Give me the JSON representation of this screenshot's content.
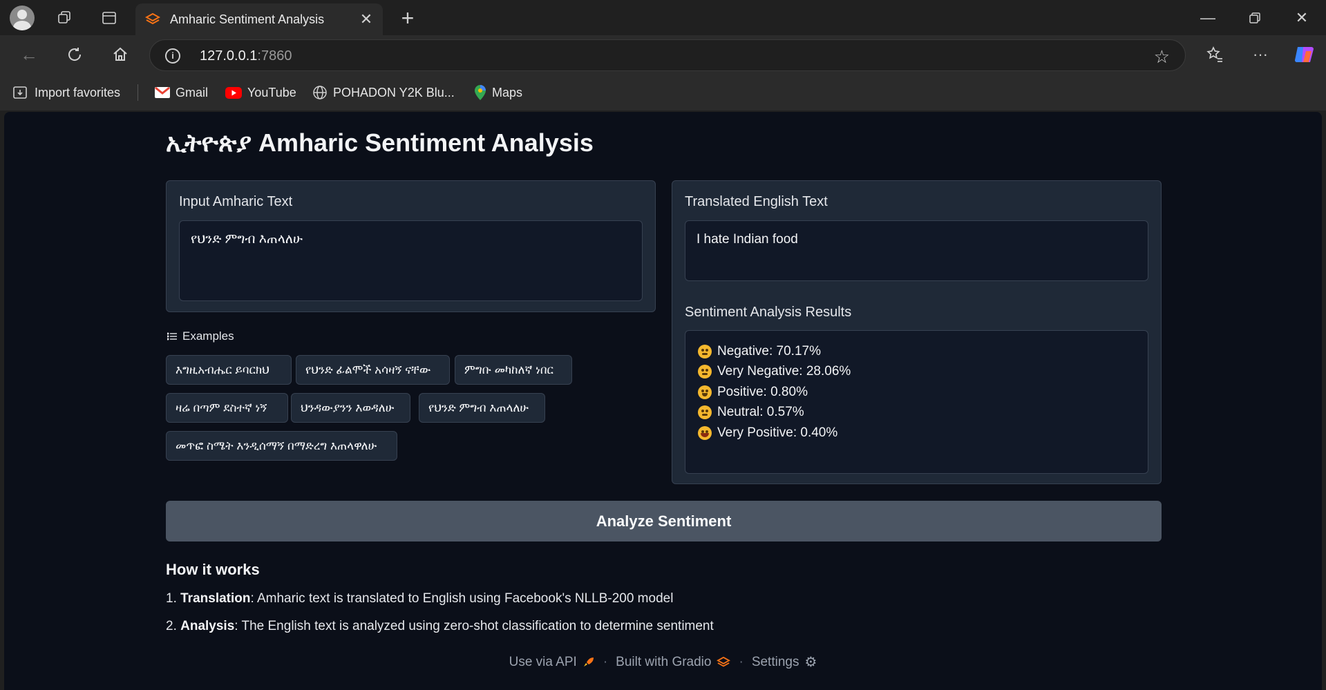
{
  "browser": {
    "tab_title": "Amharic Sentiment Analysis",
    "url_host": "127.0.0.1",
    "url_port": ":7860",
    "bookmarks": [
      "Import favorites",
      "Gmail",
      "YouTube",
      "POHADON Y2K Blu...",
      "Maps"
    ]
  },
  "app": {
    "title": "ኢትዮጵያ Amharic Sentiment Analysis",
    "input_label": "Input Amharic Text",
    "input_value": "የህንድ ምግብ እጠላለሁ",
    "examples_label": "Examples",
    "examples": [
      "እግዚአብሔር ይባርክህ",
      "የህንድ ፊልሞች አሳዛኝ ናቸው",
      "ምግቡ መካከለኛ ነበር",
      "ዛሬ በጣም ደስተኛ ነኝ",
      "ህንዳውያንን እወዳለሁ",
      "የህንድ ምግብ እጠላለሁ",
      "መጥፎ ስሜት እንዲሰማኝ በማድረግ እጠላዋለሁ"
    ],
    "translated_label": "Translated English Text",
    "translated_value": "I hate Indian food",
    "results_label": "Sentiment Analysis Results",
    "results": [
      "Negative: 70.17%",
      "Very Negative: 28.06%",
      "Positive: 0.80%",
      "Neutral: 0.57%",
      "Very Positive: 0.40%"
    ],
    "analyze_button": "Analyze Sentiment",
    "how_title": "How it works",
    "how_1_label": "Translation",
    "how_1_text": ": Amharic text is translated to English using Facebook's NLLB-200 model",
    "how_2_label": "Analysis",
    "how_2_text": ": The English text is analyzed using zero-shot classification to determine sentiment",
    "footer": {
      "api": "Use via API",
      "built": "Built with Gradio",
      "settings": "Settings"
    }
  },
  "colors": {
    "page_bg": "#0b0f19",
    "panel_bg": "#1f2937",
    "button_bg": "#4b5563",
    "gradio_orange": "#f97316"
  }
}
